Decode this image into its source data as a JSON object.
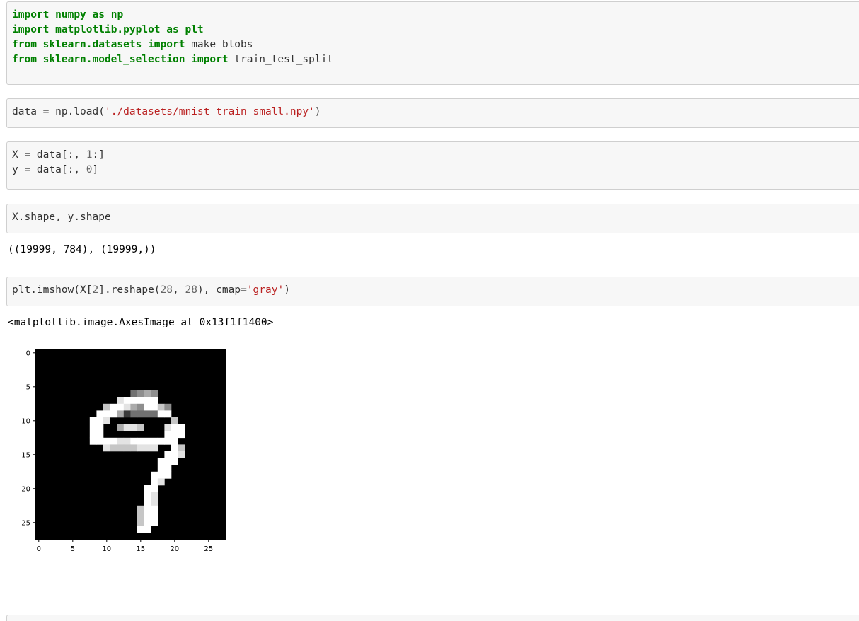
{
  "cells": [
    {
      "lines": [
        [
          [
            "import",
            "kw"
          ],
          [
            " "
          ],
          [
            "numpy",
            "kw"
          ],
          [
            " "
          ],
          [
            "as",
            "kw"
          ],
          [
            " "
          ],
          [
            "np",
            "kw"
          ]
        ],
        [
          [
            "import",
            "kw"
          ],
          [
            " "
          ],
          [
            "matplotlib.pyplot",
            "kw"
          ],
          [
            " "
          ],
          [
            "as",
            "kw"
          ],
          [
            " "
          ],
          [
            "plt",
            "kw"
          ]
        ],
        [
          [
            "from",
            "kw"
          ],
          [
            " "
          ],
          [
            "sklearn.datasets",
            "kw"
          ],
          [
            " "
          ],
          [
            "import",
            "kw"
          ],
          [
            " make_blobs"
          ]
        ],
        [
          [
            "from",
            "kw"
          ],
          [
            " "
          ],
          [
            "sklearn.model_selection",
            "kw"
          ],
          [
            " "
          ],
          [
            "import",
            "kw"
          ],
          [
            " train_test_split"
          ]
        ]
      ]
    },
    {
      "lines": [
        [
          [
            "data "
          ],
          [
            "=",
            "op"
          ],
          [
            " np.load("
          ],
          [
            "'./datasets/mnist_train_small.npy'",
            "str"
          ],
          [
            ")"
          ]
        ]
      ]
    },
    {
      "lines": [
        [
          [
            "X "
          ],
          [
            "=",
            "op"
          ],
          [
            " data[:, "
          ],
          [
            "1",
            "num"
          ],
          [
            ":]"
          ]
        ],
        [
          [
            "y "
          ],
          [
            "=",
            "op"
          ],
          [
            " data[:, "
          ],
          [
            "0",
            "num"
          ],
          [
            "]"
          ]
        ]
      ]
    },
    {
      "lines": [
        [
          [
            "X.shape, y.shape"
          ]
        ]
      ],
      "output": "((19999, 784), (19999,))"
    },
    {
      "lines": [
        [
          [
            "plt.imshow(X["
          ],
          [
            "2",
            "num"
          ],
          [
            "].reshape("
          ],
          [
            "28",
            "num"
          ],
          [
            ", "
          ],
          [
            "28",
            "num"
          ],
          [
            "), cmap"
          ],
          [
            "=",
            "op"
          ],
          [
            "'gray'",
            "str"
          ],
          [
            ")"
          ]
        ]
      ],
      "output": "<matplotlib.image.AxesImage at 0x13f1f1400>"
    },
    {
      "lines": []
    }
  ],
  "chart_data": {
    "type": "heatmap",
    "colormap": "gray",
    "size": [
      28,
      28
    ],
    "xticks": [
      "0",
      "5",
      "10",
      "15",
      "20",
      "25"
    ],
    "yticks": [
      "0",
      "5",
      "10",
      "15",
      "20",
      "25"
    ],
    "description_rows": [
      "............................",
      "............................",
      "............................",
      "............................",
      "............................",
      "............................",
      "..............4565..........",
      "............899999..........",
      "..........7998659975........",
      ".........99962444499........",
      "........998.........7.......",
      "........99..6887...899......",
      "........99.........999......",
      "........9999889999999.......",
      "..........87777888..97......",
      "...................998......",
      "..................999.......",
      "..................99........",
      ".................999........",
      ".................98.........",
      "................99..........",
      "................98..........",
      "................98..........",
      "...............799..........",
      "...............799..........",
      "...............799..........",
      "...............99...........",
      "............................"
    ]
  }
}
